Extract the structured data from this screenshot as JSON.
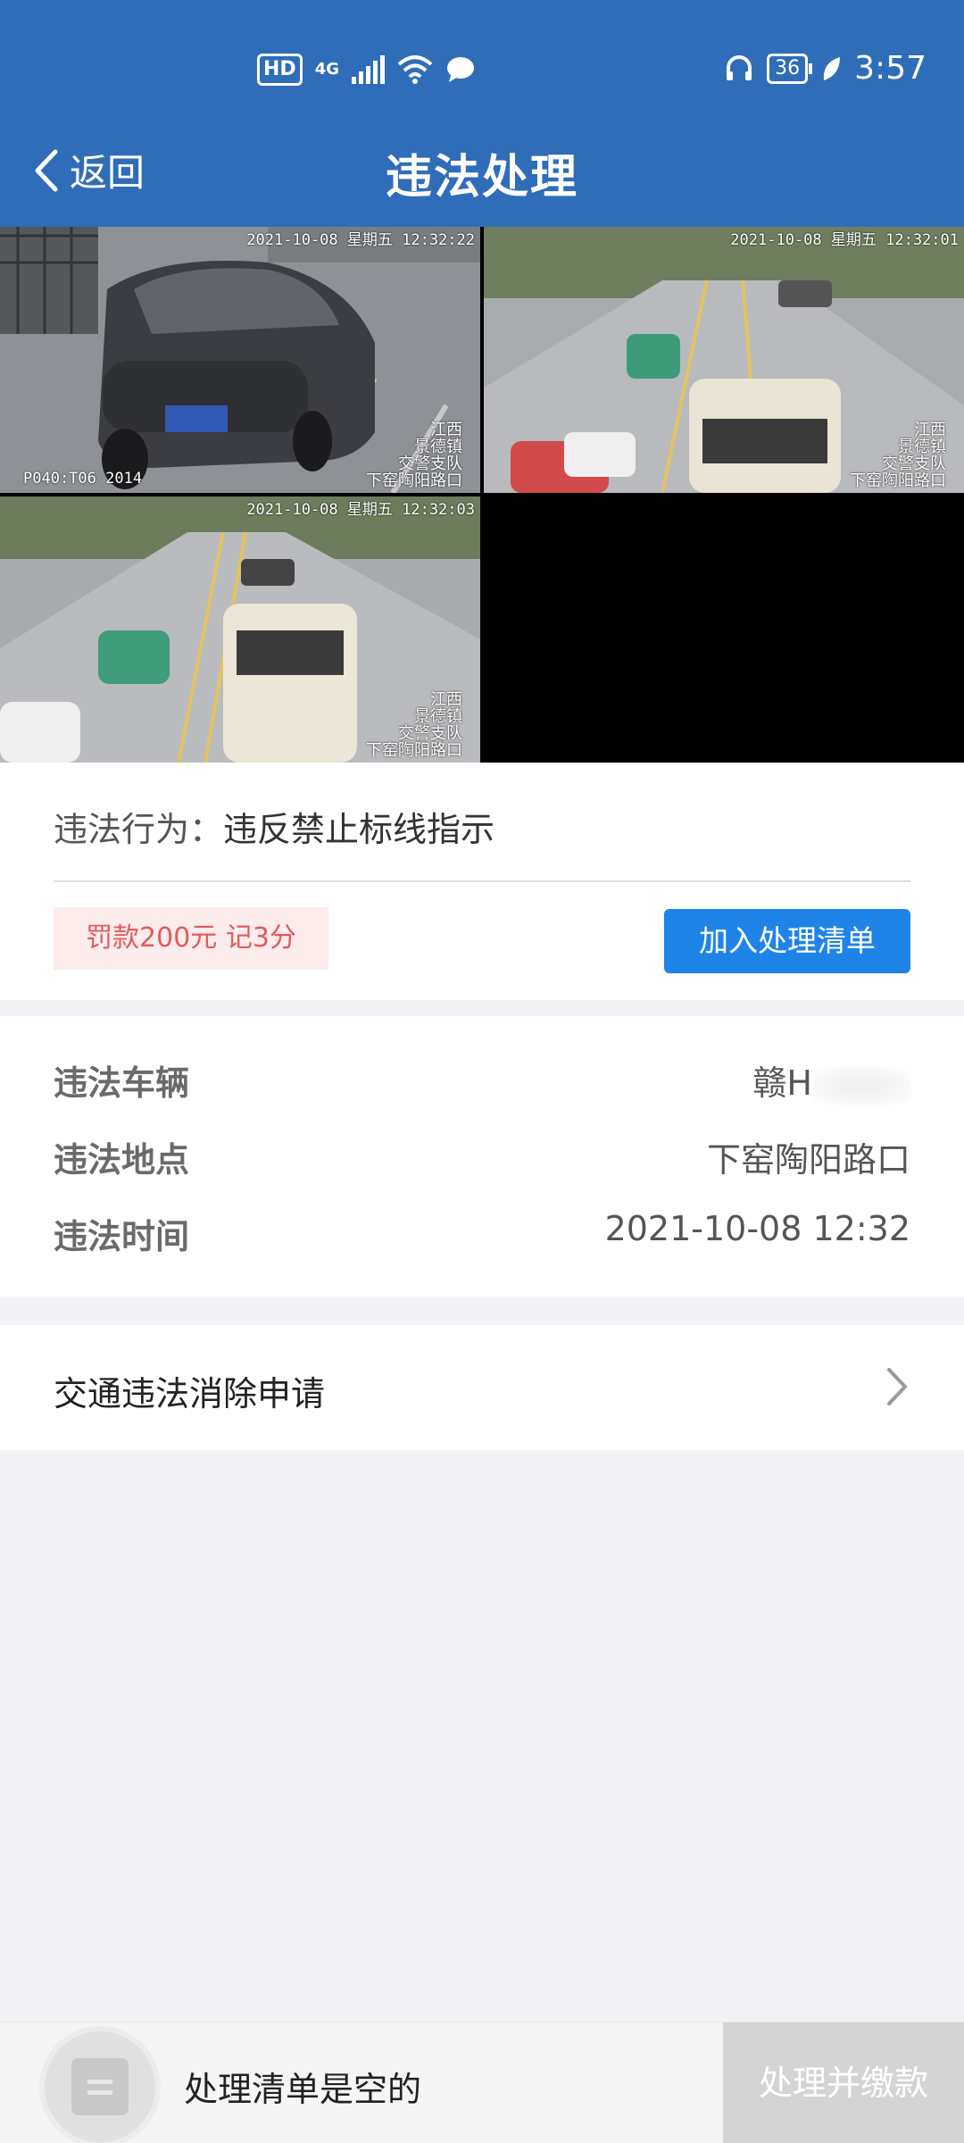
{
  "status_bar": {
    "hd": "HD",
    "network": "4G",
    "battery": "36",
    "time": "3:57"
  },
  "header": {
    "back_label": "返回",
    "title": "违法处理"
  },
  "photos": [
    {
      "timestamp": "2021-10-08 星期五 12:32:22",
      "location_lines": [
        "江西",
        "景德镇",
        "交警支队",
        "下窑陶阳路口"
      ],
      "code": "P040:T06   2014"
    },
    {
      "timestamp": "2021-10-08 星期五 12:32:01",
      "location_lines": [
        "江西",
        "景德镇",
        "交警支队",
        "下窑陶阳路口"
      ]
    },
    {
      "timestamp": "2021-10-08 星期五 12:32:03",
      "location_lines": [
        "江西",
        "景德镇",
        "交警支队",
        "下窑陶阳路口"
      ]
    }
  ],
  "violation": {
    "behavior_label": "违法行为：",
    "behavior_value": "违反禁止标线指示",
    "penalty": "罚款200元 记3分",
    "add_button": "加入处理清单"
  },
  "details": {
    "vehicle_label": "违法车辆",
    "vehicle_value": "赣H",
    "location_label": "违法地点",
    "location_value": "下窑陶阳路口",
    "time_label": "违法时间",
    "time_value": "2021-10-08 12:32"
  },
  "elimination": {
    "label": "交通违法消除申请"
  },
  "bottom": {
    "empty_text": "处理清单是空的",
    "pay_button": "处理并缴款"
  },
  "colors": {
    "header_bg": "#2f6db8",
    "primary_button": "#1f84e8",
    "penalty_bg": "#fdecec",
    "penalty_text": "#e25b5b"
  }
}
